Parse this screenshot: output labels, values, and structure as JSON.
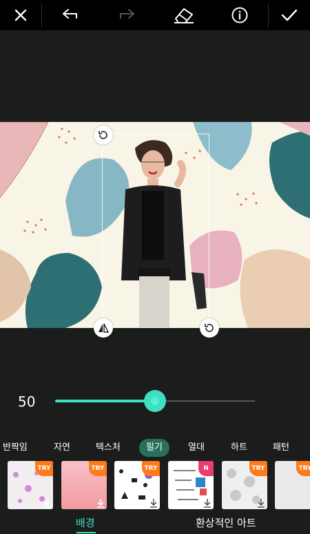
{
  "toolbar": {
    "close": "close-icon",
    "undo": "undo-icon",
    "redo": "redo-icon",
    "eraser": "eraser-icon",
    "info": "info-icon",
    "apply": "check-icon"
  },
  "slider": {
    "value_label": "50",
    "fraction": 0.5,
    "accent": "#3ee0c2"
  },
  "categories": [
    {
      "label": "반짝임"
    },
    {
      "label": "자연"
    },
    {
      "label": "텍스처"
    },
    {
      "label": "필기",
      "active": true
    },
    {
      "label": "열대"
    },
    {
      "label": "하트"
    },
    {
      "label": "패턴"
    }
  ],
  "thumbnails": [
    {
      "badge": "TRY"
    },
    {
      "badge": "TRY"
    },
    {
      "badge": "TRY"
    },
    {
      "badge": "N"
    },
    {
      "badge": "TRY"
    },
    {
      "badge": "TRY"
    }
  ],
  "bottom_tabs": [
    {
      "label": "배경",
      "active": true
    },
    {
      "label": "환상적인 아트"
    }
  ]
}
